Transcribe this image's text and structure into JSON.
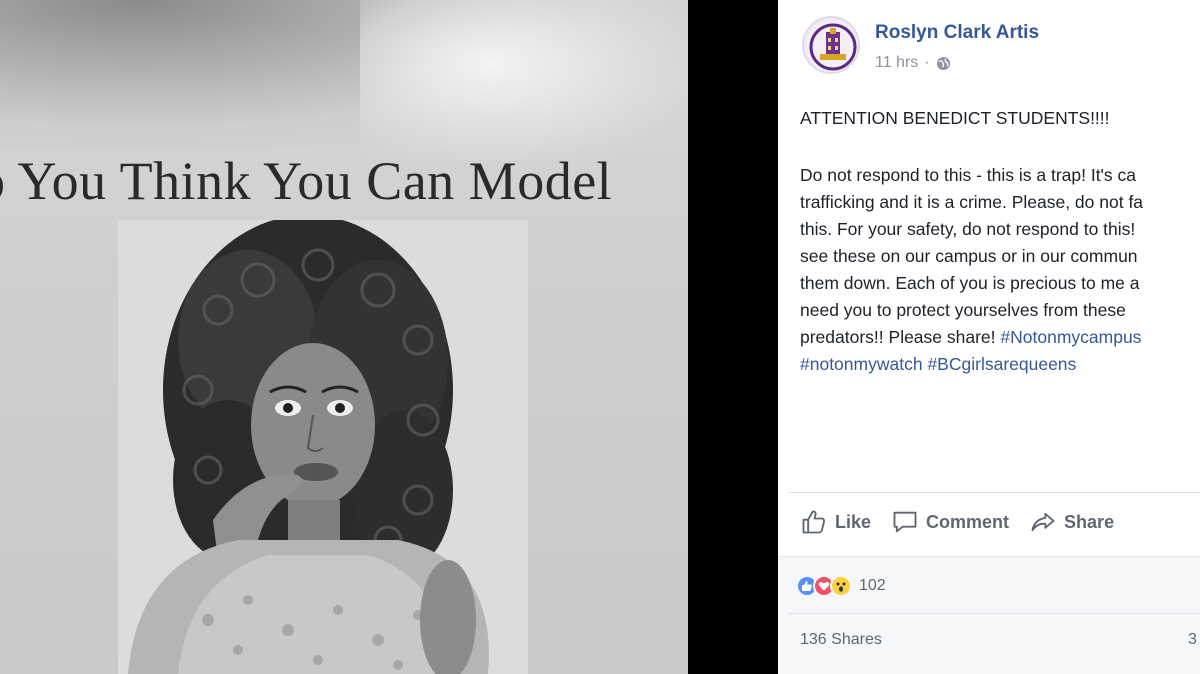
{
  "photo": {
    "poster_title": "o You Think You Can Model"
  },
  "post": {
    "author": "Roslyn Clark Artis",
    "time": "11 hrs",
    "separator": "·",
    "headline": "ATTENTION BENEDICT STUDENTS!!!!",
    "body_lines": [
      "Do not respond to this - this is a trap! It's ca",
      "trafficking and it is a crime. Please, do not fa",
      "this. For your safety, do not respond to this!",
      "see these on our campus or in our commun",
      "them down. Each of you is precious to me a",
      "need you to protect yourselves from these"
    ],
    "line7_text": "predators!! Please share! ",
    "hashtag_1": "#Notonmycampus",
    "hashtag_2": "#notonmywatch",
    "hashtag_3": "#BCgirlsarequeens",
    "actions": {
      "like": "Like",
      "comment": "Comment",
      "share": "Share"
    },
    "reactions": {
      "types": [
        "like",
        "love",
        "wow"
      ],
      "count": "102"
    },
    "shares": "136 Shares",
    "comments_count": "3"
  },
  "colors": {
    "link": "#365899",
    "text": "#1d2129",
    "muted": "#90949c",
    "like_blue": "#5890ff",
    "love_red": "#f25268",
    "wow_yellow": "#fcd13f"
  }
}
